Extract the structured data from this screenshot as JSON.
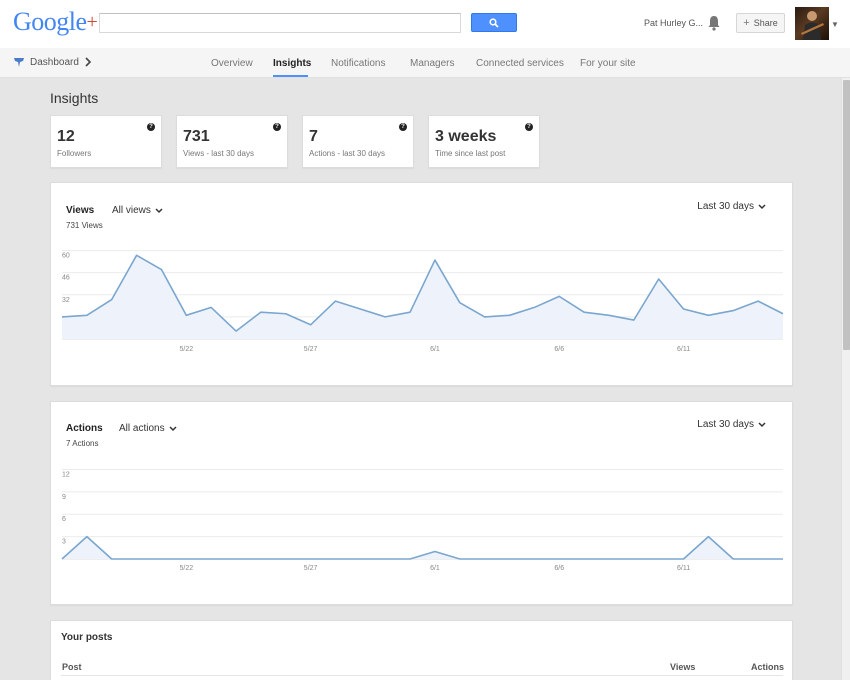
{
  "header": {
    "logo_text": "Google",
    "logo_plus": "+",
    "user_name": "Pat Hurley G...",
    "share_label": "Share",
    "share_plus": "+"
  },
  "subnav": {
    "dashboard_label": "Dashboard",
    "tabs": [
      {
        "label": "Overview",
        "active": false
      },
      {
        "label": "Insights",
        "active": true
      },
      {
        "label": "Notifications",
        "active": false
      },
      {
        "label": "Managers",
        "active": false
      },
      {
        "label": "Connected services",
        "active": false
      },
      {
        "label": "For your site",
        "active": false
      }
    ]
  },
  "page": {
    "title": "Insights"
  },
  "stats": [
    {
      "value": "12",
      "label": "Followers"
    },
    {
      "value": "731",
      "label": "Views - last 30 days"
    },
    {
      "value": "7",
      "label": "Actions - last 30 days"
    },
    {
      "value": "3 weeks",
      "label": "Time since last post"
    }
  ],
  "views_card": {
    "title": "Views",
    "filter": "All views",
    "summary": "731 Views",
    "range": "Last 30 days"
  },
  "actions_card": {
    "title": "Actions",
    "filter": "All actions",
    "summary": "7 Actions",
    "range": "Last 30 days"
  },
  "posts_card": {
    "title": "Your posts",
    "col_post": "Post",
    "col_views": "Views",
    "col_actions": "Actions"
  },
  "colors": {
    "accent": "#4d90fe",
    "line": "#7aa6cf",
    "area": "#eef3fb"
  },
  "chart_data": [
    {
      "type": "area",
      "title": "Views",
      "yticks": [
        18,
        32,
        46,
        60
      ],
      "ylim": [
        4,
        61
      ],
      "x_tick_labels": [
        {
          "index": 5,
          "label": "5/22"
        },
        {
          "index": 10,
          "label": "5/27"
        },
        {
          "index": 15,
          "label": "6/1"
        },
        {
          "index": 20,
          "label": "6/6"
        },
        {
          "index": 25,
          "label": "6/11"
        }
      ],
      "series": [
        {
          "values": [
            18,
            19,
            29,
            57,
            48,
            19,
            24,
            9,
            21,
            20,
            13,
            28,
            23,
            18,
            21,
            54,
            27,
            18,
            19,
            24,
            31,
            21,
            19,
            16,
            42,
            23,
            19,
            22,
            28,
            20
          ]
        }
      ]
    },
    {
      "type": "area",
      "title": "Actions",
      "yticks": [
        3,
        6,
        9,
        12
      ],
      "ylim": [
        0,
        12.6
      ],
      "x_tick_labels": [
        {
          "index": 5,
          "label": "5/22"
        },
        {
          "index": 10,
          "label": "5/27"
        },
        {
          "index": 15,
          "label": "6/1"
        },
        {
          "index": 20,
          "label": "6/6"
        },
        {
          "index": 25,
          "label": "6/11"
        }
      ],
      "series": [
        {
          "values": [
            0,
            3,
            0,
            0,
            0,
            0,
            0,
            0,
            0,
            0,
            0,
            0,
            0,
            0,
            0,
            1,
            0,
            0,
            0,
            0,
            0,
            0,
            0,
            0,
            0,
            0,
            3,
            0,
            0,
            0
          ]
        }
      ]
    }
  ]
}
